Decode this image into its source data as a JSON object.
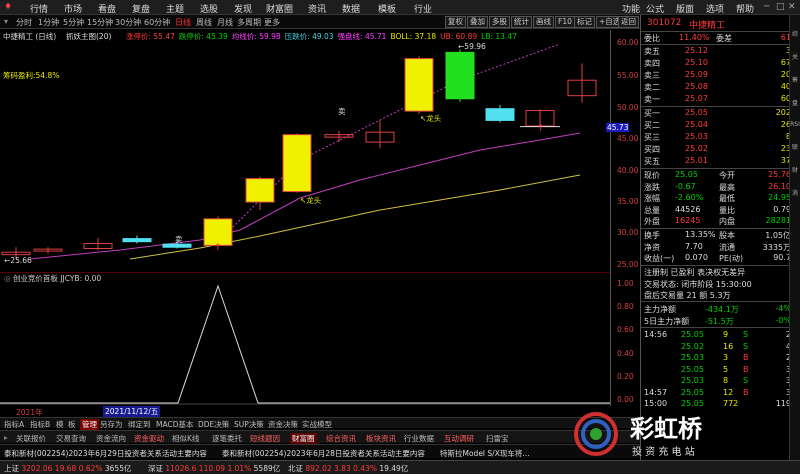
{
  "menu": {
    "left_items": [
      "行情",
      "市场",
      "看盘",
      "复盘",
      "主题",
      "选股",
      "发现",
      "财富圈",
      "资讯",
      "数据",
      "模板",
      "行业"
    ],
    "right_items": [
      "功能",
      "公式",
      "版面",
      "选项",
      "帮助"
    ]
  },
  "toolbar": {
    "periods": [
      "分时",
      "1分钟",
      "5分钟",
      "15分钟",
      "30分钟",
      "60分钟",
      "日线",
      "周线",
      "月线",
      "多周期",
      "更多"
    ],
    "active_period": "日线",
    "buttons": [
      "复权",
      "叠加",
      "多股",
      "统计",
      "画线",
      "F10",
      "标记",
      "+自选",
      "返回"
    ]
  },
  "indicator_line": {
    "title": "中捷精工 (日线)",
    "theme": "抓妖主图(20)",
    "items": [
      {
        "label": "涨停价: 55.47",
        "color": "#ff3b3b"
      },
      {
        "label": "跌停价: 45.39",
        "color": "#00d000"
      },
      {
        "label": "均线价: 59.98",
        "color": "#ff40ff"
      },
      {
        "label": "压跌价: 49.03",
        "color": "#40d0e0"
      },
      {
        "label": "强盘线: 45.71",
        "color": "#ff40ff"
      },
      {
        "label": "BOLL: 37.18",
        "color": "#e8e800"
      },
      {
        "label": "UB: 60.89",
        "color": "#ff3b3b"
      },
      {
        "label": "LB: 13.47",
        "color": "#00d000"
      }
    ]
  },
  "chart_labels": {
    "profit_ratio": "筹码盈利:54.8%",
    "high_marker": "59.96",
    "low_marker": "25.66",
    "sell_1": "卖",
    "sell_2": "卖",
    "dragon_1": "龙头",
    "dragon_2": "龙头",
    "current_price_tag": "45.73"
  },
  "price_axis": [
    "60.00",
    "55.00",
    "50.00",
    "45.00",
    "40.00",
    "35.00",
    "30.00",
    "25.00"
  ],
  "sub_chart": {
    "title": "创业竞价首板 JJCYB: 0.00",
    "axis": [
      "1.00",
      "0.80",
      "0.60",
      "0.40",
      "0.20",
      "0.00"
    ]
  },
  "date_strip": {
    "year": "2021年",
    "date": "2021/11/12/五"
  },
  "tabs_row1": [
    "指标A",
    "指标B",
    "模",
    "板",
    "管理",
    "另存为",
    "绑定到",
    "MACD基本",
    "DDE决策",
    "SUP决策",
    "资金决策",
    "实战模型"
  ],
  "tabs_row1_active": "管理",
  "tabs_row2": [
    "关联报价",
    "交易查询",
    "资金流向",
    "资金驱动",
    "相似K线",
    "逐笔委托",
    "短线题因",
    "财富圈",
    "综合资讯",
    "板块资讯",
    "行业数据",
    "互动调研",
    "扫雷宝"
  ],
  "news": [
    "泰和新材(002254)2023年6月29日投资者关系活动主要内容",
    "泰和新材(002254)2023年6月28日投资者关系活动主要内容",
    "特斯拉Model S/X现车将…"
  ],
  "status": [
    {
      "label": "上证",
      "value": "3202.06",
      "chg": "19.68",
      "pct": "0.62%",
      "amt": "3655亿"
    },
    {
      "label": "深证",
      "value": "11026.6",
      "chg": "110.09",
      "pct": "1.01%",
      "amt": "5589亿"
    },
    {
      "label": "北证",
      "value": "892.02",
      "chg": "3.83",
      "pct": "0.43%",
      "amt": "19.49亿"
    }
  ],
  "stock": {
    "code": "301072",
    "name": "中捷精工",
    "weibi_label": "委比",
    "weibi": "11.40%",
    "weicha_label": "委差",
    "weicha": "61",
    "asks": [
      {
        "label": "卖五",
        "price": "25.12",
        "vol": "3"
      },
      {
        "label": "卖四",
        "price": "25.10",
        "vol": "67"
      },
      {
        "label": "卖三",
        "price": "25.09",
        "vol": "20"
      },
      {
        "label": "卖二",
        "price": "25.08",
        "vol": "40"
      },
      {
        "label": "卖一",
        "price": "25.07",
        "vol": "60"
      }
    ],
    "bids": [
      {
        "label": "买一",
        "price": "25.05",
        "vol": "202"
      },
      {
        "label": "买二",
        "price": "25.04",
        "vol": "26"
      },
      {
        "label": "买三",
        "price": "25.03",
        "vol": "8"
      },
      {
        "label": "买四",
        "price": "25.02",
        "vol": "23"
      },
      {
        "label": "买五",
        "price": "25.01",
        "vol": "37"
      }
    ],
    "stats": [
      {
        "k1": "现价",
        "v1": "25.05",
        "c1": "green",
        "k2": "今开",
        "v2": "25.76",
        "c2": "red"
      },
      {
        "k1": "涨跌",
        "v1": "-0.67",
        "c1": "green",
        "k2": "最高",
        "v2": "26.10",
        "c2": "red"
      },
      {
        "k1": "涨幅",
        "v1": "-2.60%",
        "c1": "green",
        "k2": "最低",
        "v2": "24.95",
        "c2": "green"
      },
      {
        "k1": "总量",
        "v1": "44526",
        "c1": "white",
        "k2": "量比",
        "v2": "0.79",
        "c2": "white"
      },
      {
        "k1": "外盘",
        "v1": "16245",
        "c1": "red",
        "k2": "内盘",
        "v2": "28281",
        "c2": "green"
      }
    ],
    "stats2": [
      {
        "k1": "换手",
        "v1": "13.35%",
        "k2": "股本",
        "v2": "1.05亿"
      },
      {
        "k1": "净资",
        "v1": "7.70",
        "k2": "流通",
        "v2": "3335万"
      },
      {
        "k1": "收益(一)",
        "v1": "0.070",
        "k2": "PE(动)",
        "v2": "90.7"
      }
    ],
    "notes": [
      "注册制 已盈利 表决权无差异",
      "交易状态: 闭市阶段 15:30:00",
      "盘后交易量 21 额 5.3万"
    ],
    "flows": [
      {
        "label": "主力净额",
        "value": "-434.1万",
        "pct": "-4%"
      },
      {
        "label": "5日主力净额",
        "value": "-51.5万",
        "pct": "-0%"
      }
    ],
    "ticks": [
      {
        "time": "14:56",
        "price": "25.05",
        "vol": "9",
        "side": "S",
        "n": "2"
      },
      {
        "time": "",
        "price": "25.02",
        "vol": "16",
        "side": "S",
        "n": "4"
      },
      {
        "time": "",
        "price": "25.03",
        "vol": "3",
        "side": "B",
        "n": "2"
      },
      {
        "time": "",
        "price": "25.05",
        "vol": "5",
        "side": "B",
        "n": "3"
      },
      {
        "time": "",
        "price": "25.03",
        "vol": "8",
        "side": "S",
        "n": "3"
      },
      {
        "time": "14:57",
        "price": "25.05",
        "vol": "12",
        "side": "B",
        "n": "3"
      },
      {
        "time": "15:00",
        "price": "25.05",
        "vol": "772",
        "side": "",
        "n": "119"
      }
    ]
  },
  "right_side_tabs": [
    "综",
    "关",
    "筹",
    "盘",
    "RSI",
    "联",
    "财",
    "消"
  ],
  "watermark": {
    "title": "彩虹桥",
    "subtitle": "投 资 充 电 站"
  }
}
